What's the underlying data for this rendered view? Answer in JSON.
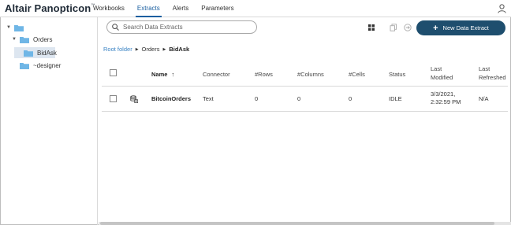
{
  "app": {
    "brand": "Altair Panopticon",
    "brand_tm": "™"
  },
  "nav": [
    {
      "label": "Workbooks",
      "active": false
    },
    {
      "label": "Extracts",
      "active": true
    },
    {
      "label": "Alerts",
      "active": false
    },
    {
      "label": "Parameters",
      "active": false
    }
  ],
  "sidebar": {
    "items": [
      {
        "label": "",
        "level": 0,
        "expanded": true
      },
      {
        "label": "Orders",
        "level": 1,
        "expanded": true
      },
      {
        "label": "BidAsk",
        "level": 2,
        "selected": true
      },
      {
        "label": "~designer",
        "level": 1
      }
    ]
  },
  "search": {
    "placeholder": "Search Data Extracts"
  },
  "toolbar": {
    "new_label": "New Data Extract"
  },
  "breadcrumb": {
    "root": "Root folder",
    "folder": "Orders",
    "current": "BidAsk"
  },
  "table": {
    "headers": {
      "name": "Name",
      "connector": "Connector",
      "rows": "#Rows",
      "columns": "#Columns",
      "cells": "#Cells",
      "status": "Status",
      "modified_1": "Last",
      "modified_2": "Modified",
      "refreshed_1": "Last",
      "refreshed_2": "Refreshed"
    },
    "row": {
      "name": "BitcoinOrders",
      "connector": "Text",
      "rows": "0",
      "columns": "0",
      "cells": "0",
      "status": "IDLE",
      "modified_1": "3/3/2021,",
      "modified_2": "2:32:59 PM",
      "refreshed": "N/A"
    }
  },
  "colors": {
    "accent": "#1a5fa0",
    "button": "#1e4e6e",
    "folder": "#6fb6e6",
    "selected": "#dde6f0"
  }
}
